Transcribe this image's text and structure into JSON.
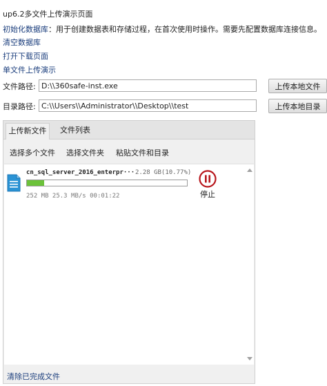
{
  "page": {
    "title": "up6.2多文件上传演示页面",
    "init_link": "初始化数据库",
    "init_desc": "：用于创建数据表和存储过程，在首次使用时操作。需要先配置数据库连接信息。",
    "clear_db_link": "清空数据库",
    "open_download_link": "打开下载页面",
    "single_upload_link": "单文件上传演示"
  },
  "file_path": {
    "label": "文件路径:",
    "value": "D:\\\\360safe-inst.exe",
    "button": "上传本地文件"
  },
  "dir_path": {
    "label": "目录路径:",
    "value": "C:\\\\Users\\\\Administrator\\\\Desktop\\\\test",
    "button": "上传本地目录"
  },
  "tabs": [
    {
      "label": "上传新文件",
      "active": true
    },
    {
      "label": "文件列表",
      "active": false
    }
  ],
  "toolbar": {
    "select_files": "选择多个文件",
    "select_folder": "选择文件夹",
    "paste": "粘贴文件和目录"
  },
  "upload_item": {
    "name": "cn_sql_server_2016_enterpr···",
    "size_progress": "2.28 GB(10.77%)",
    "progress": 0.1077,
    "stats": "252 MB 25.3 MB/s 00:01:22",
    "stop_label": "停止",
    "icon": "document-icon"
  },
  "footer": {
    "clear_completed": "清除已完成文件"
  },
  "colors": {
    "link": "#1a3d7c",
    "progress_fill": "#6cc23a",
    "stop_icon": "#b8161c",
    "file_icon": "#2a93d5"
  }
}
